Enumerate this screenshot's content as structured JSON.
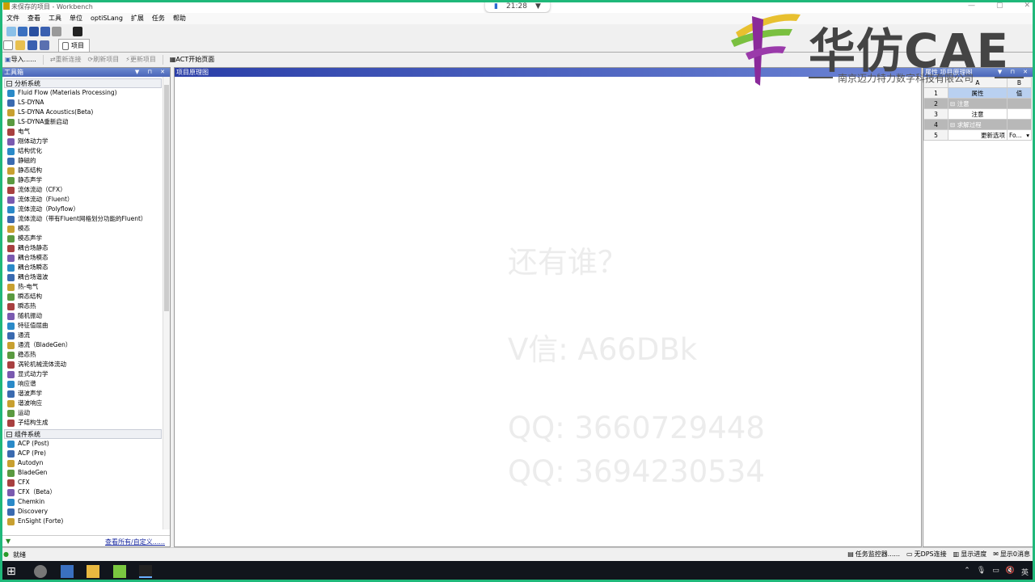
{
  "window": {
    "title": "未保存的项目 - Workbench",
    "buttons": [
      "—",
      "▢",
      "✕"
    ]
  },
  "clock": {
    "time": "21:28"
  },
  "menu": [
    "文件",
    "查看",
    "工具",
    "单位",
    "optiSLang",
    "扩展",
    "任务",
    "帮助"
  ],
  "tab": {
    "label": "项目"
  },
  "toolbar2": {
    "import": "导入......",
    "reconnect": "重新连接",
    "refresh": "刷新项目",
    "update": "更新项目",
    "act": "ACT开始页面"
  },
  "toolbox": {
    "title": "工具箱",
    "group1": "分析系统",
    "analysis_items": [
      "Fluid Flow (Materials Processing)",
      "LS-DYNA",
      "LS-DYNA Acoustics(Beta)",
      "LS-DYNA重新启动",
      "电气",
      "刚体动力学",
      "结构优化",
      "静磁的",
      "静态结构",
      "静态声学",
      "流体流动（CFX）",
      "流体流动（Fluent）",
      "流体流动（Polyflow）",
      "流体流动（带有Fluent网格划分功能的Fluent）",
      "模态",
      "模态声学",
      "耦合场静态",
      "耦合场模态",
      "耦合场瞬态",
      "耦合场谐波",
      "热-电气",
      "瞬态结构",
      "瞬态热",
      "随机振动",
      "特征值屈曲",
      "通流",
      "通流（BladeGen）",
      "稳态热",
      "涡轮机械流体流动",
      "显式动力学",
      "响应谱",
      "谐波声学",
      "谐波响应",
      "运动",
      "子结构生成"
    ],
    "group2": "组件系统",
    "component_items": [
      "ACP (Post)",
      "ACP (Pre)",
      "Autodyn",
      "BladeGen",
      "CFX",
      "CFX（Beta）",
      "Chemkin",
      "Discovery",
      "EnSight (Forte)"
    ],
    "view_all": "查看所有/自定义......"
  },
  "schematic": {
    "title": "项目原理图",
    "watermarks": [
      "还有谁？",
      "V信: A66DBk",
      "QQ: 3660729448",
      "QQ: 3694230534"
    ]
  },
  "properties": {
    "title": "属性 项目原理图",
    "col_a": "A",
    "col_b": "B",
    "rows": [
      {
        "n": "1",
        "a": "属性",
        "b": "值"
      },
      {
        "n": "2",
        "a": "注意",
        "b": ""
      },
      {
        "n": "3",
        "a": "注意",
        "b": ""
      },
      {
        "n": "4",
        "a": "求解过程",
        "b": ""
      },
      {
        "n": "5",
        "a": "更新选项",
        "b": "Fo..."
      }
    ]
  },
  "status": {
    "ready": "就绪",
    "job_monitor": "任务监控器......",
    "dps": "无DPS连接",
    "progress": "显示进度",
    "messages": "显示0消息"
  },
  "logo": {
    "brand": "华仿CAE",
    "company": "南京迈力特力数字科技有限公司"
  },
  "taskbar": {
    "ime": "英"
  },
  "colors": {
    "accent_border": "#1fb87a",
    "header_blue": "#4a66b8"
  }
}
